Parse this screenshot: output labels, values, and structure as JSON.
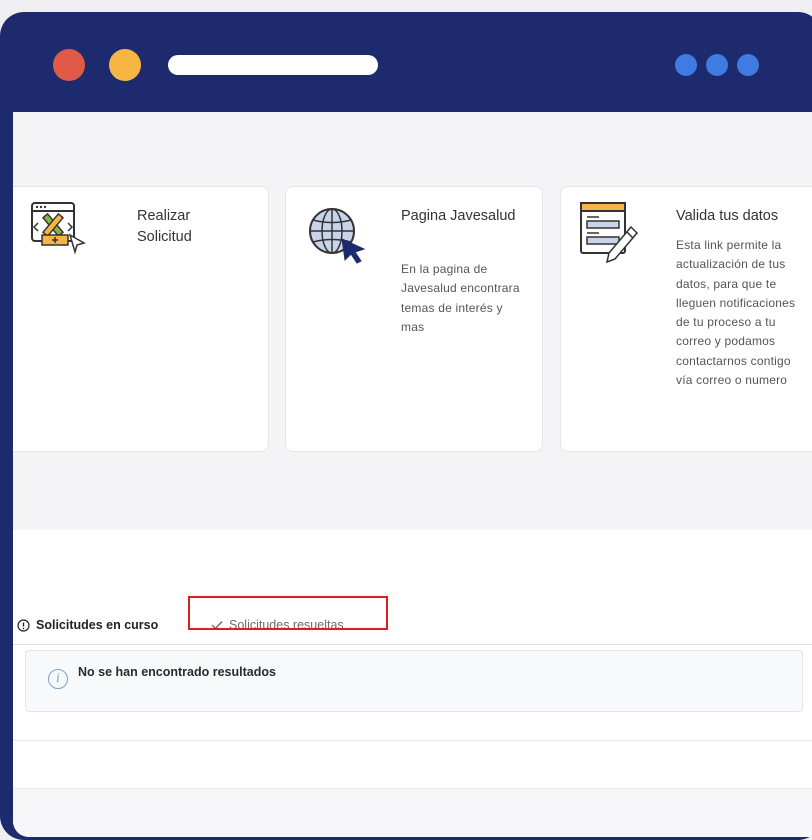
{
  "window": {
    "controls": [
      "close-dot",
      "minimize-dot"
    ],
    "colors": {
      "frame": "#1e2a6e",
      "close": "#e05a48",
      "minimize": "#f7b643",
      "menu_dots": "#3f7be0"
    }
  },
  "cards": [
    {
      "title": "Realizar Solicitud",
      "description": "",
      "icon": "tools-window-icon"
    },
    {
      "title": "Pagina Javesalud",
      "description": "En la pagina de Javesalud encontrara temas de interés y mas",
      "icon": "globe-cursor-icon"
    },
    {
      "title": "Valida tus datos",
      "description": "Esta link permite la actualización de tus datos, para que te lleguen notificaciones de tu proceso a tu correo y podamos contactarnos contigo vía correo o numero",
      "icon": "form-pencil-icon"
    }
  ],
  "tabs": {
    "active": {
      "label": "Solicitudes en curso",
      "icon": "exclamation-circle-icon"
    },
    "resolved": {
      "label": "Solicitudes resueltas",
      "icon": "check-icon"
    }
  },
  "alert": {
    "message": "No se han encontrado resultados",
    "icon": "info-icon"
  },
  "highlight_color": "#e01e1e"
}
